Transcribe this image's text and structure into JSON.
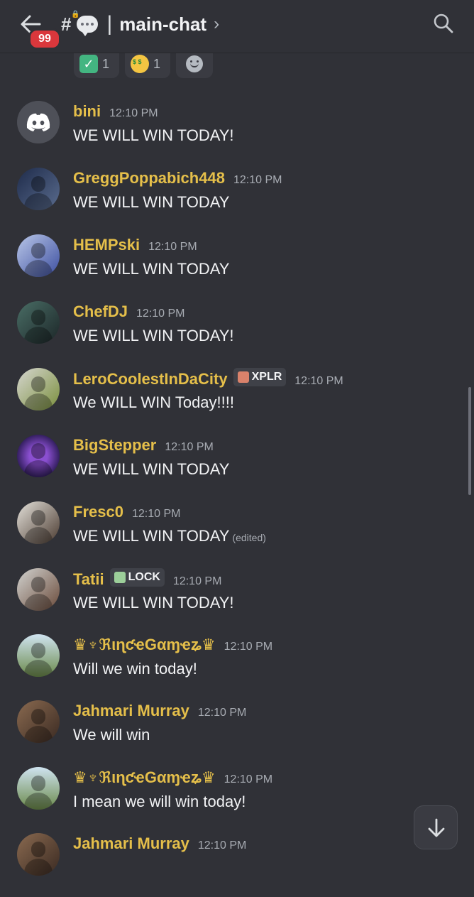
{
  "header": {
    "unread_count": "99",
    "channel_name": "main-chat",
    "title_divider": "|",
    "chevron": "›"
  },
  "reactions": [
    {
      "emoji": "check-mark-button",
      "count": "1"
    },
    {
      "emoji": "money-mouth-face",
      "count": "1"
    }
  ],
  "messages": [
    {
      "username": "bini",
      "time": "12:10 PM",
      "text": "WE WILL WIN TODAY!",
      "avatar": "discord-default"
    },
    {
      "username": "GreggPoppabich448",
      "time": "12:10 PM",
      "text": "WE WILL WIN TODAY",
      "avatar": "photo"
    },
    {
      "username": "HEMPski",
      "time": "12:10 PM",
      "text": "WE WILL WIN TODAY",
      "avatar": "photo"
    },
    {
      "username": "ChefDJ",
      "time": "12:10 PM",
      "text": "WE WILL WIN TODAY!",
      "avatar": "photo"
    },
    {
      "username": "LeroCoolestInDaCity",
      "tag": "XPLR",
      "time": "12:10 PM",
      "text": "We WILL WIN Today!!!!",
      "avatar": "photo"
    },
    {
      "username": "BigStepper",
      "time": "12:10 PM",
      "text": "WE WILL WIN TODAY",
      "avatar": "photo"
    },
    {
      "username": "Fresc0",
      "time": "12:10 PM",
      "text": "WE WILL WIN TODAY",
      "edited": "(edited)",
      "avatar": "photo"
    },
    {
      "username": "Tatii",
      "tag": "LOCK",
      "time": "12:10 PM",
      "text": "WE WILL WIN TODAY!",
      "avatar": "photo"
    },
    {
      "username": "♛♆ℜιɳƈҽGαɱҽʑ♛",
      "time": "12:10 PM",
      "text": "Will we win today!",
      "avatar": "photo"
    },
    {
      "username": "Jahmari Murray",
      "time": "12:10 PM",
      "text": "We will win",
      "avatar": "photo"
    },
    {
      "username": "♛♆ℜιɳƈҽGαɱҽʑ♛",
      "time": "12:10 PM",
      "text": "I mean we will win today!",
      "avatar": "photo"
    },
    {
      "username": "Jahmari Murray",
      "time": "12:10 PM",
      "text": "",
      "avatar": "photo"
    }
  ],
  "colors": {
    "background": "#303137",
    "username": "#e5bf4a",
    "timestamp": "#a8acb3",
    "badge": "#da373c"
  },
  "icons": {
    "back": "arrow-left-icon",
    "channel": "hash-lock-icon",
    "channel_emoji": "speech-bubble-icon",
    "search": "search-icon",
    "jump": "arrow-down-icon",
    "add_reaction": "add-reaction-icon"
  }
}
